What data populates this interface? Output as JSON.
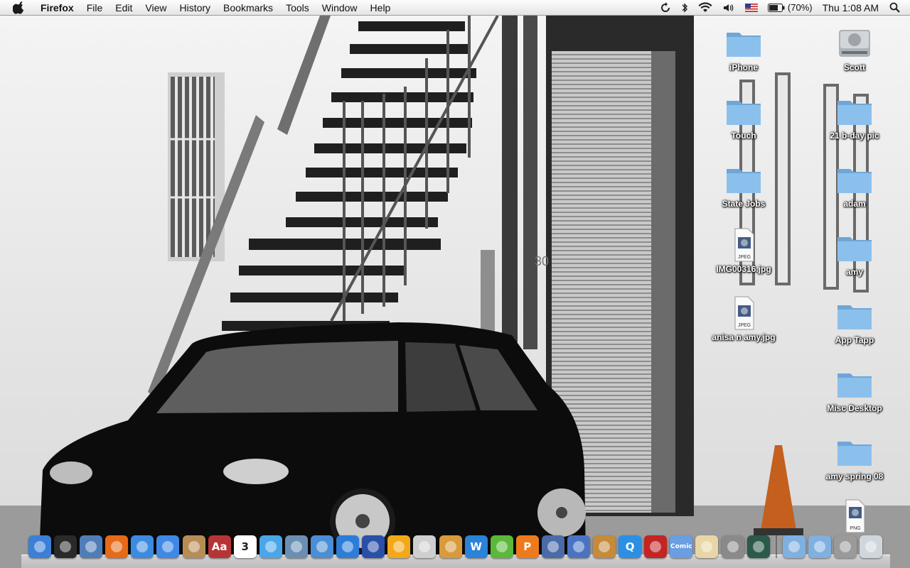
{
  "menubar": {
    "apple_icon": "apple-logo-icon",
    "app_name": "Firefox",
    "menus": [
      "File",
      "Edit",
      "View",
      "History",
      "Bookmarks",
      "Tools",
      "Window",
      "Help"
    ],
    "status": {
      "icons": [
        "time-machine-sync-icon",
        "bluetooth-icon",
        "wifi-icon",
        "volume-icon",
        "us-flag-input-icon",
        "battery-icon"
      ],
      "battery_percent": "(70%)",
      "clock": "Thu 1:08 AM",
      "spotlight_icon": "spotlight-search-icon"
    }
  },
  "desktop": {
    "icons": [
      {
        "label": "iPhone",
        "type": "folder"
      },
      {
        "label": "Scott",
        "type": "hard-drive"
      },
      {
        "label": "Touch",
        "type": "folder"
      },
      {
        "label": "21 b-day pic",
        "type": "folder"
      },
      {
        "label": "State Jobs",
        "type": "folder"
      },
      {
        "label": "adam",
        "type": "folder"
      },
      {
        "label": "IMG00316.jpg",
        "type": "jpeg",
        "badge": "JPEG"
      },
      {
        "label": "amy",
        "type": "folder"
      },
      {
        "label": "anisa n amy.jpg",
        "type": "jpeg",
        "badge": "JPEG"
      },
      {
        "label": "App Tapp",
        "type": "folder"
      },
      {
        "label": "Misc Desktop",
        "type": "folder"
      },
      {
        "label": "amy spring 08",
        "type": "folder"
      },
      {
        "label": "",
        "type": "png",
        "badge": "PNG"
      }
    ]
  },
  "wallpaper": {
    "description_icon": "black-car-wallpaper",
    "plate_text": "30"
  },
  "dock": {
    "apps": [
      {
        "name": "finder-icon",
        "color": "#3b7fd6"
      },
      {
        "name": "dashboard-icon",
        "color": "#2a2a2a"
      },
      {
        "name": "mail-stamp-icon",
        "color": "#4f7db8"
      },
      {
        "name": "firefox-icon",
        "color": "#e66a17"
      },
      {
        "name": "safari-icon",
        "color": "#3c8be0"
      },
      {
        "name": "ichat-icon",
        "color": "#3f88e6"
      },
      {
        "name": "address-book-icon",
        "color": "#b88d55"
      },
      {
        "name": "dictionary-icon",
        "color": "#b83434",
        "glyph": "Aa"
      },
      {
        "name": "ical-icon",
        "color": "#ffffff",
        "glyph": "3"
      },
      {
        "name": "itunes-icon",
        "color": "#4aa6e8"
      },
      {
        "name": "iphoto-icon",
        "color": "#6b8fb4"
      },
      {
        "name": "imovie-icon",
        "color": "#4a8ed6"
      },
      {
        "name": "idvd-icon",
        "color": "#2d7dd8"
      },
      {
        "name": "dashcode-icon",
        "color": "#2a4fa8"
      },
      {
        "name": "caution-sign-icon",
        "color": "#f2a818"
      },
      {
        "name": "camera-icon",
        "color": "#cfcfcf"
      },
      {
        "name": "garageband-icon",
        "color": "#d89a3a"
      },
      {
        "name": "iweb-icon",
        "color": "#2a83d8",
        "glyph": "W"
      },
      {
        "name": "logo-green-icon",
        "color": "#5ab83a"
      },
      {
        "name": "orange-p-icon",
        "color": "#ee7a1e",
        "glyph": "P"
      },
      {
        "name": "xcode-icon",
        "color": "#4a6aa8"
      },
      {
        "name": "keynote-icon",
        "color": "#4a74c2"
      },
      {
        "name": "preview-icon",
        "color": "#c58b3a"
      },
      {
        "name": "quicktime-icon",
        "color": "#2b8fe6",
        "glyph": "Q"
      },
      {
        "name": "photo-booth-icon",
        "color": "#c42424"
      },
      {
        "name": "comic-life-icon",
        "color": "#6a9ee0",
        "glyph": "Comic"
      },
      {
        "name": "script-editor-icon",
        "color": "#e8d6a6"
      },
      {
        "name": "system-preferences-icon",
        "color": "#8a8a8a"
      },
      {
        "name": "time-machine-icon",
        "color": "#2a5a4a"
      }
    ],
    "stacks": [
      {
        "name": "applications-folder-icon",
        "color": "#7fb0e0"
      },
      {
        "name": "documents-folder-icon",
        "color": "#7fb0e0"
      },
      {
        "name": "downloads-stack-icon",
        "color": "#9a9a9a"
      },
      {
        "name": "trash-icon",
        "color": "#cfd6dc"
      }
    ]
  }
}
